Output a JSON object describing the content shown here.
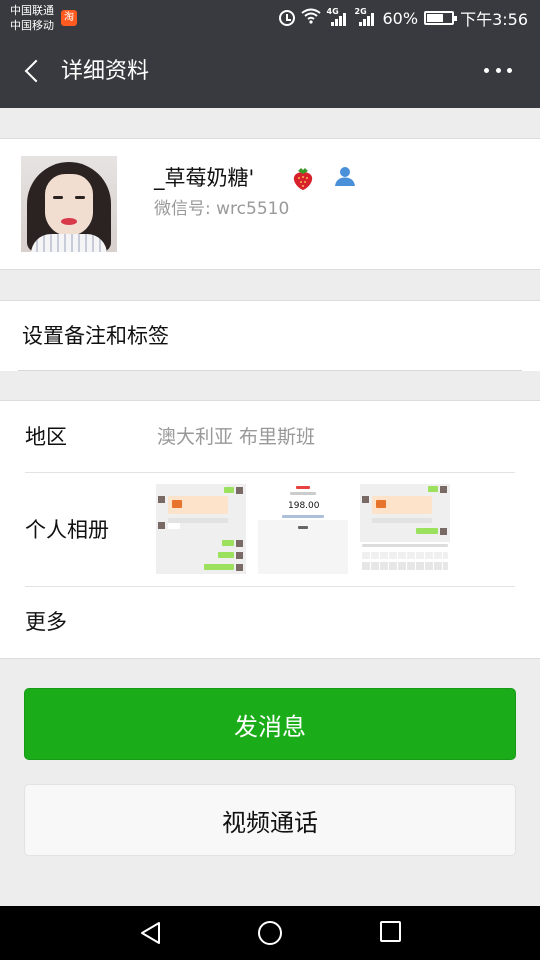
{
  "status_bar": {
    "carrier1": "中国联通",
    "carrier2": "中国移动",
    "taobao_icon_text": "淘",
    "net1": "4G",
    "net2": "2G",
    "battery_percent": "60%",
    "time": "下午3:56",
    "icons": [
      "taobao-icon",
      "alarm-icon",
      "wifi-icon",
      "signal-icon",
      "battery-icon"
    ]
  },
  "header": {
    "title": "详细资料",
    "icons": [
      "back-icon",
      "more-icon"
    ]
  },
  "profile": {
    "name": "_草莓奶糖'",
    "wechat_id": "微信号: wrc5510",
    "icons": [
      "strawberry-icon",
      "contact-icon"
    ]
  },
  "remark": {
    "label": "设置备注和标签"
  },
  "info": {
    "region_label": "地区",
    "region_value": "澳大利亚  布里斯班",
    "album_label": "个人相册",
    "more_label": "更多",
    "album_thumb_amount": "198.00"
  },
  "actions": {
    "send_message": "发消息",
    "video_call": "视频通话"
  },
  "nav": {
    "icons": [
      "nav-back-icon",
      "nav-home-icon",
      "nav-recent-icon"
    ]
  },
  "colors": {
    "header_bg": "#393a3f",
    "accent_green": "#1aad19",
    "page_bg": "#ededed"
  }
}
